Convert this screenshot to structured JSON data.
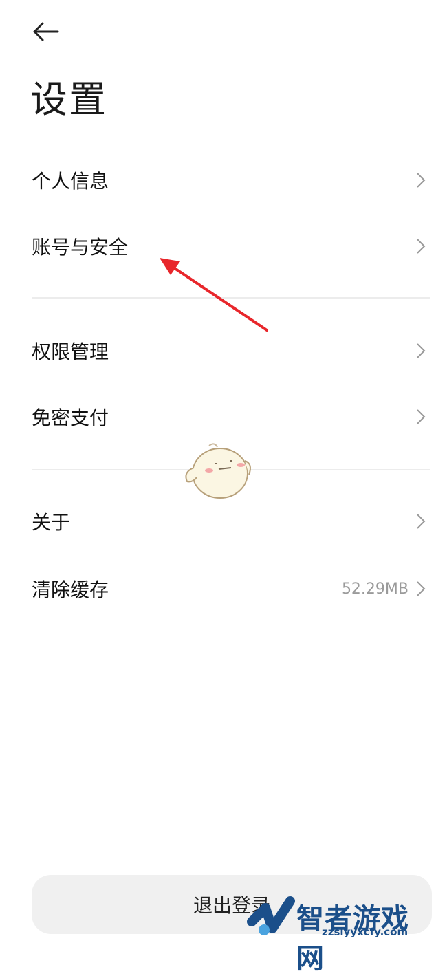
{
  "header": {
    "back_icon": "arrow-left-icon",
    "title": "设置"
  },
  "settings": {
    "group1": [
      {
        "label": "个人信息",
        "icon": "chevron-right-icon"
      },
      {
        "label": "账号与安全",
        "icon": "chevron-right-icon"
      }
    ],
    "group2": [
      {
        "label": "权限管理",
        "icon": "chevron-right-icon"
      },
      {
        "label": "免密支付",
        "icon": "chevron-right-icon"
      }
    ],
    "group3": [
      {
        "label": "关于",
        "icon": "chevron-right-icon"
      },
      {
        "label": "清除缓存",
        "value": "52.29MB",
        "icon": "chevron-right-icon"
      }
    ]
  },
  "footer": {
    "logout_label": "退出登录"
  },
  "watermark": {
    "text": "智者游戏网",
    "url": "zzslyyxcfy.com"
  },
  "colors": {
    "annotation_arrow": "#e8262b",
    "accent_watermark": "#1b4f8a"
  }
}
